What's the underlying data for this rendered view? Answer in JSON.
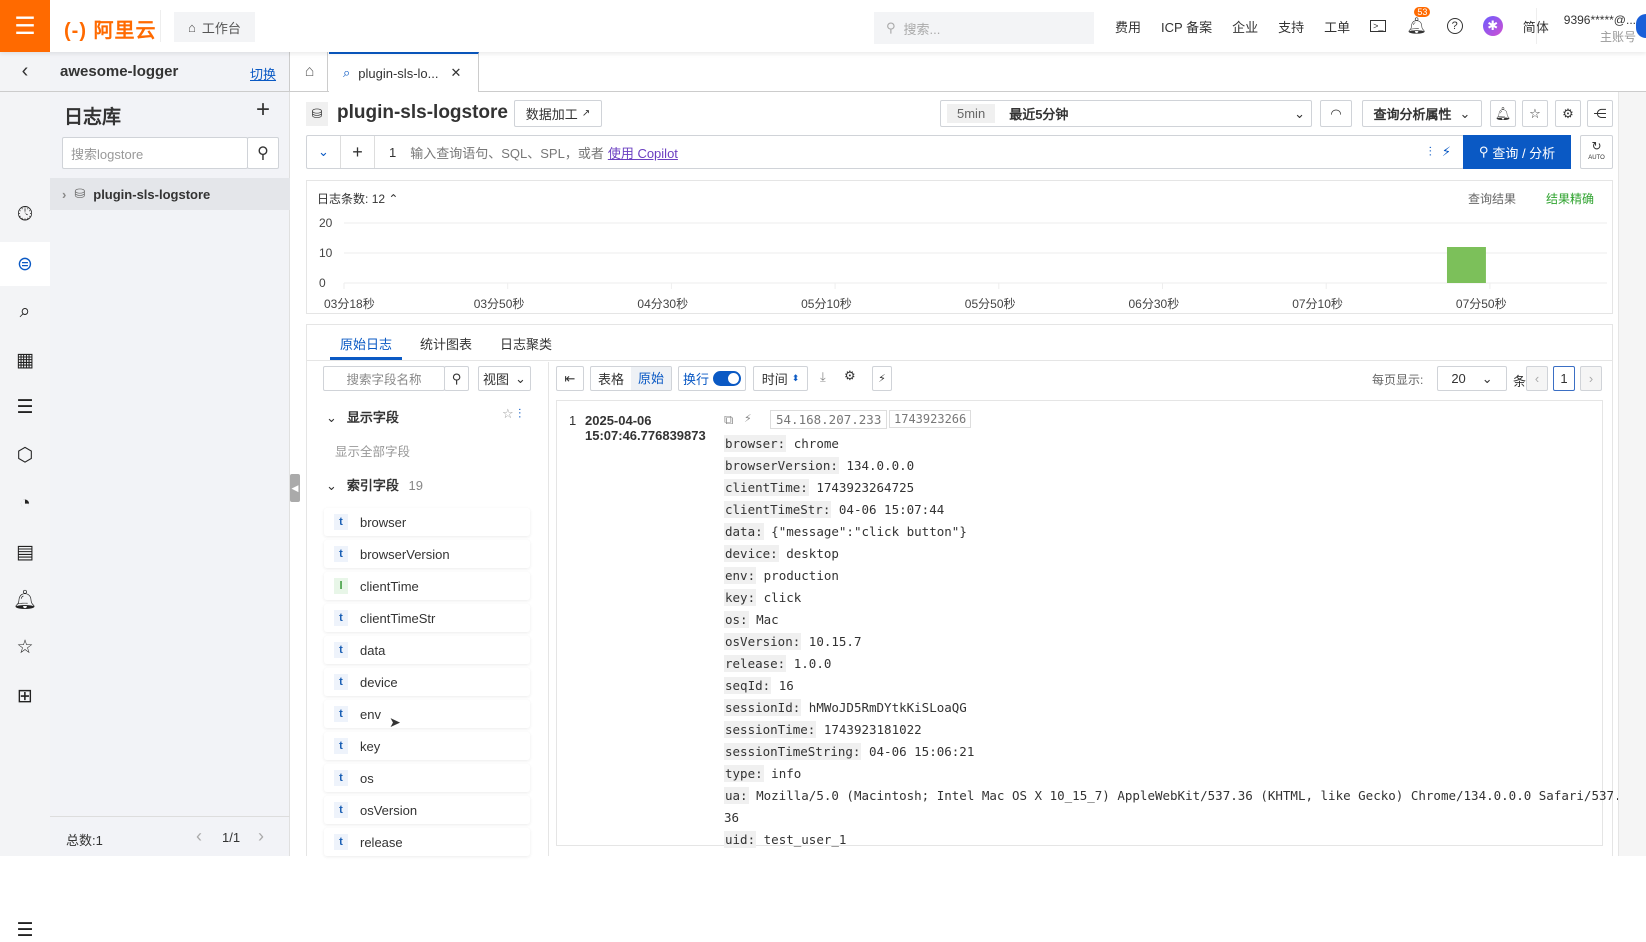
{
  "topbar": {
    "brand": "(-) 阿里云",
    "workbench": "工作台",
    "search_placeholder": "搜索...",
    "nav": [
      "费用",
      "ICP 备案",
      "企业",
      "支持",
      "工单"
    ],
    "notifications": "53",
    "language": "简体",
    "account": "9396*****@...",
    "account_role": "主账号",
    "brand_color": "#ff6a00"
  },
  "project": {
    "name": "awesome-logger",
    "switch": "切换"
  },
  "tabs": [
    {
      "label": "plugin-sls-lo...",
      "active": true
    }
  ],
  "left_panel": {
    "title": "日志库",
    "search_placeholder": "搜索logstore",
    "items": [
      "plugin-sls-logstore"
    ],
    "total": "总数:1",
    "page": "1/1"
  },
  "header": {
    "logstore": "plugin-sls-logstore",
    "data_process": "数据加工",
    "time_badge": "5min",
    "time_range": "最近5分钟",
    "query_props": "查询分析属性"
  },
  "query": {
    "line_no": "1",
    "placeholder": "输入查询语句、SQL、SPL，或者",
    "copilot": "使用 Copilot",
    "submit": "查询 / 分析",
    "auto": "AUTO",
    "accent": "#0a59c4"
  },
  "histogram": {
    "count_label": "日志条数:",
    "count": "12",
    "result_label": "查询结果",
    "result_status": "结果精确"
  },
  "chart_data": {
    "type": "bar",
    "title": "",
    "xlabel": "",
    "ylabel": "",
    "ylim": [
      0,
      20
    ],
    "yticks": [
      0,
      10,
      20
    ],
    "xlim_seconds": [
      198,
      506
    ],
    "xticks": [
      {
        "sec": 198,
        "label": "03分18秒"
      },
      {
        "sec": 230,
        "label": "03分50秒"
      },
      {
        "sec": 270,
        "label": "04分30秒"
      },
      {
        "sec": 310,
        "label": "05分10秒"
      },
      {
        "sec": 350,
        "label": "05分50秒"
      },
      {
        "sec": 390,
        "label": "06分30秒"
      },
      {
        "sec": 430,
        "label": "07分10秒"
      },
      {
        "sec": 470,
        "label": "07分50秒"
      }
    ],
    "bars": [
      {
        "start_sec": 466,
        "width_sec": 10,
        "value": 12
      }
    ],
    "bar_color": "#7cc05a",
    "grid": true
  },
  "result_tabs": [
    "原始日志",
    "统计图表",
    "日志聚类"
  ],
  "fields_panel": {
    "search_placeholder": "搜索字段名称",
    "view": "视图",
    "display_fields": "显示字段",
    "show_all": "显示全部字段",
    "index_fields": "索引字段",
    "index_count": "19",
    "fields": [
      {
        "t": "t",
        "name": "browser"
      },
      {
        "t": "t",
        "name": "browserVersion"
      },
      {
        "t": "l",
        "name": "clientTime"
      },
      {
        "t": "t",
        "name": "clientTimeStr"
      },
      {
        "t": "t",
        "name": "data"
      },
      {
        "t": "t",
        "name": "device"
      },
      {
        "t": "t",
        "name": "env"
      },
      {
        "t": "t",
        "name": "key"
      },
      {
        "t": "t",
        "name": "os"
      },
      {
        "t": "t",
        "name": "osVersion"
      },
      {
        "t": "t",
        "name": "release"
      }
    ]
  },
  "log_toolbar": {
    "table": "表格",
    "raw": "原始",
    "wrap": "换行",
    "time": "时间",
    "per_page_label": "每页显示:",
    "per_page": "20",
    "unit": "条",
    "page": "1"
  },
  "log": {
    "index": "1",
    "date": "2025-04-06",
    "time": "15:07:46.776839873",
    "ip": "54.168.207.233",
    "ts": "1743923266",
    "entries": [
      [
        "browser:",
        "chrome"
      ],
      [
        "browserVersion:",
        "134.0.0.0"
      ],
      [
        "clientTime:",
        "1743923264725"
      ],
      [
        "clientTimeStr:",
        "04-06 15:07:44"
      ],
      [
        "data:",
        "{\"message\":\"click button\"}"
      ],
      [
        "device:",
        "desktop"
      ],
      [
        "env:",
        "production"
      ],
      [
        "key:",
        "click"
      ],
      [
        "os:",
        "Mac"
      ],
      [
        "osVersion:",
        "10.15.7"
      ],
      [
        "release:",
        "1.0.0"
      ],
      [
        "seqId:",
        "16"
      ],
      [
        "sessionId:",
        "hMWoJD5RmDYtkKiSLoaQG"
      ],
      [
        "sessionTime:",
        "1743923181022"
      ],
      [
        "sessionTimeString:",
        "04-06 15:06:21"
      ],
      [
        "type:",
        "info"
      ],
      [
        "ua:",
        "Mozilla/5.0 (Macintosh; Intel Mac OS X 10_15_7) AppleWebKit/537.36 (KHTML, like Gecko) Chrome/134.0.0.0 Safari/537."
      ],
      [
        "",
        "36"
      ],
      [
        "uid:",
        "test_user_1"
      ]
    ]
  }
}
